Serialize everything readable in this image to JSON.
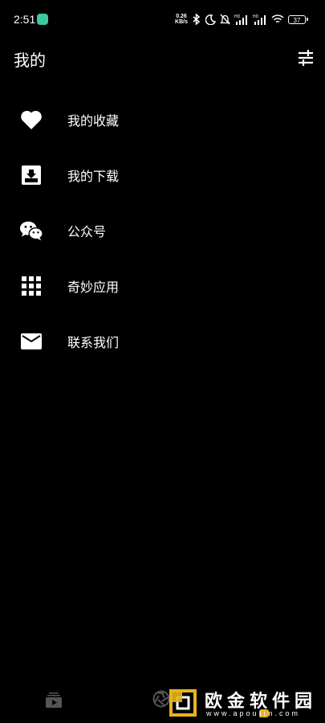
{
  "status_bar": {
    "time": "2:51",
    "net_speed_value": "0.26",
    "net_speed_unit": "KB/s",
    "battery": "37",
    "icons": [
      "app-notification-icon",
      "bluetooth-icon",
      "moon-icon",
      "mute-bell-icon",
      "hd-signal-icon",
      "hd-signal-icon",
      "wifi-icon",
      "battery-icon"
    ]
  },
  "header": {
    "title": "我的",
    "settings_icon": "sliders-icon"
  },
  "menu": {
    "items": [
      {
        "label": "我的收藏",
        "icon": "heart-icon"
      },
      {
        "label": "我的下载",
        "icon": "download-box-icon"
      },
      {
        "label": "公众号",
        "icon": "wechat-icon"
      },
      {
        "label": "奇妙应用",
        "icon": "apps-grid-icon"
      },
      {
        "label": "联系我们",
        "icon": "mail-icon"
      }
    ]
  },
  "bottom_nav": {
    "tabs": [
      {
        "icon": "video-library-icon"
      },
      {
        "icon": "aperture-icon"
      }
    ]
  },
  "watermark": {
    "text": "欧金软件园",
    "url_prefix": "www.",
    "url_mid": "apou",
    "url_hl": "ji",
    "url_end": "n.com"
  },
  "colors": {
    "background": "#000000",
    "text": "#ffffff",
    "watermark_accent": "#e7b41c"
  }
}
